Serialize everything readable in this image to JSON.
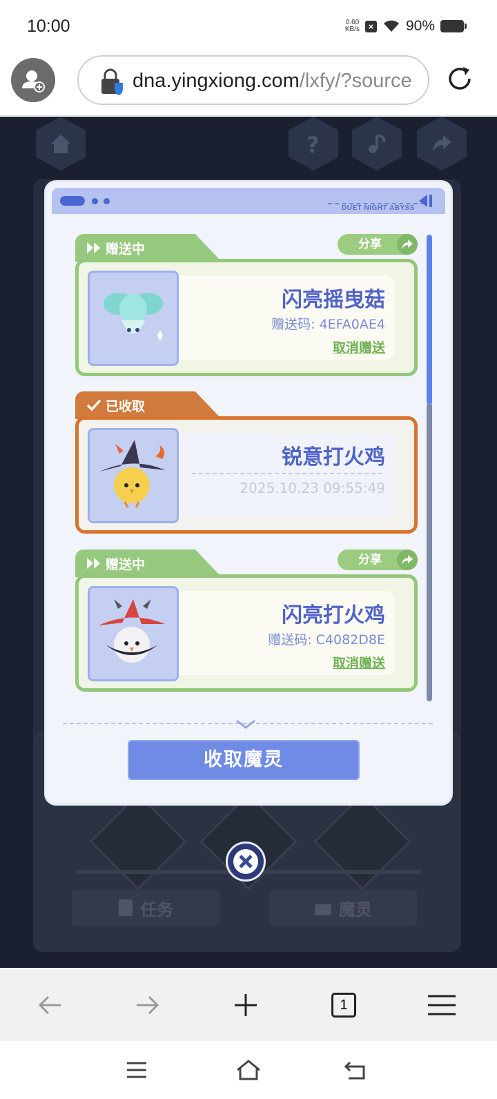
{
  "status_bar": {
    "time": "10:00",
    "net_speed_value": "0.60",
    "net_speed_unit": "KB/s",
    "battery": "90%"
  },
  "browser": {
    "url_domain": "dna.yingxiong.com",
    "url_path": "/lxfy/?source",
    "tab_count": "1"
  },
  "modal": {
    "header_text": "DUET NIGHT ABYSS",
    "cards": [
      {
        "status": "赠送中",
        "share_label": "分享",
        "name": "闪亮摇曳菇",
        "code_label": "赠送码: ",
        "code": "4EFA0AE4",
        "cancel_label": "取消赠送"
      },
      {
        "status": "已收取",
        "name": "锐意打火鸡",
        "date": "2025.10.23 09:55:49"
      },
      {
        "status": "赠送中",
        "share_label": "分享",
        "name": "闪亮打火鸡",
        "code_label": "赠送码: ",
        "code": "C4082D8E",
        "cancel_label": "取消赠送"
      }
    ],
    "collect_button": "收取魔灵"
  },
  "background": {
    "tab_task": "任务",
    "tab_spirit": "魔灵"
  }
}
